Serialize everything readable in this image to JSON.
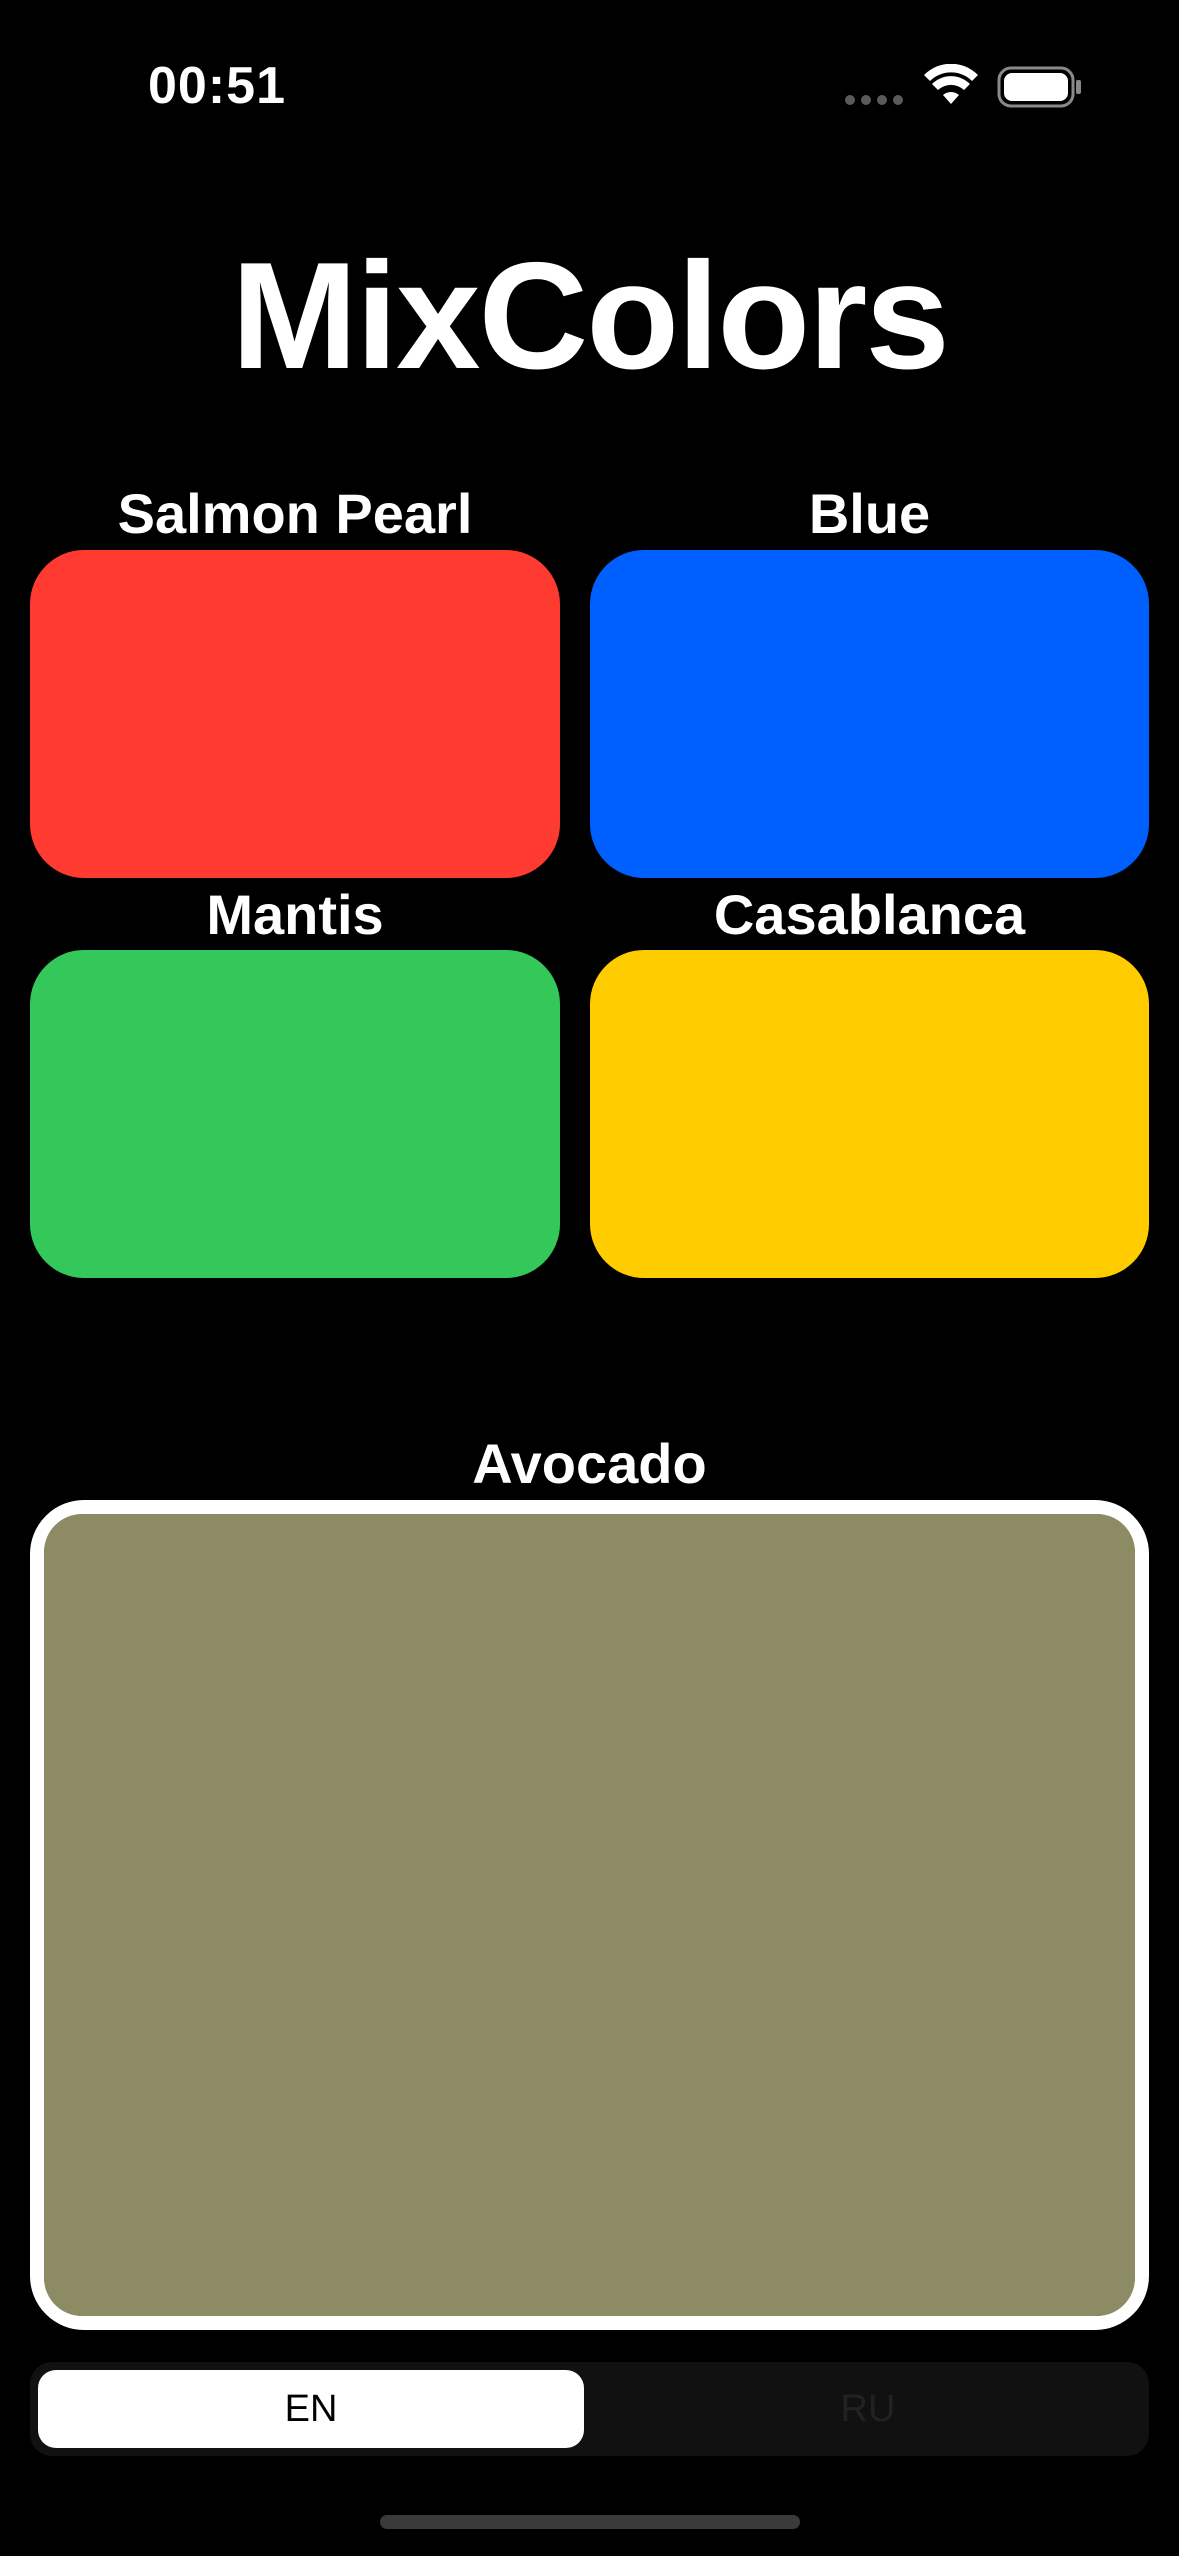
{
  "status_bar": {
    "time": "00:51",
    "icons": [
      "cellular-dots-icon",
      "wifi-icon",
      "battery-icon"
    ]
  },
  "app": {
    "title": "MixColors"
  },
  "swatches": [
    {
      "label": "Salmon Pearl",
      "color": "#ff3a30"
    },
    {
      "label": "Blue",
      "color": "#0060ff"
    },
    {
      "label": "Mantis",
      "color": "#34c759"
    },
    {
      "label": "Casablanca",
      "color": "#ffcc00"
    }
  ],
  "result": {
    "label": "Avocado",
    "color": "#8d8b63",
    "border_color": "#ffffff"
  },
  "language_picker": {
    "options": [
      "EN",
      "RU"
    ],
    "selected": "EN"
  }
}
